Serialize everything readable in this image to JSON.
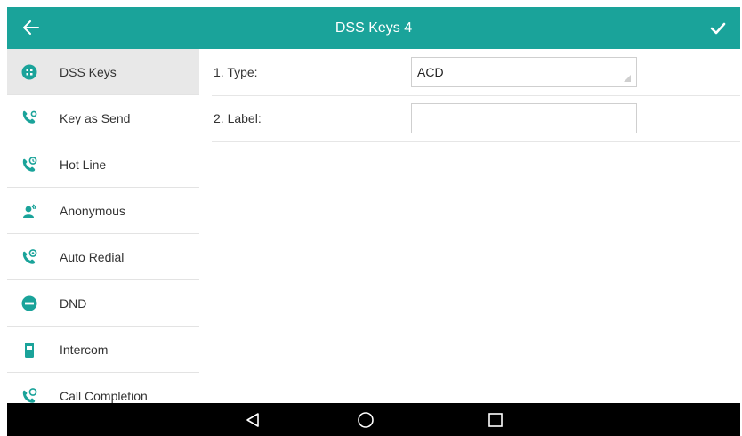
{
  "header": {
    "title": "DSS Keys 4",
    "back_icon": "back-arrow-icon",
    "confirm_icon": "checkmark-icon"
  },
  "sidebar": {
    "items": [
      {
        "label": "DSS Keys",
        "icon": "dss-keys-icon",
        "active": true
      },
      {
        "label": "Key as Send",
        "icon": "key-as-send-icon",
        "active": false
      },
      {
        "label": "Hot Line",
        "icon": "hot-line-icon",
        "active": false
      },
      {
        "label": "Anonymous",
        "icon": "anonymous-icon",
        "active": false
      },
      {
        "label": "Auto Redial",
        "icon": "auto-redial-icon",
        "active": false
      },
      {
        "label": "DND",
        "icon": "dnd-icon",
        "active": false
      },
      {
        "label": "Intercom",
        "icon": "intercom-icon",
        "active": false
      },
      {
        "label": "Call Completion",
        "icon": "call-completion-icon",
        "active": false
      }
    ]
  },
  "form": {
    "type_label": "1. Type:",
    "type_value": "ACD",
    "label_label": "2. Label:",
    "label_value": ""
  },
  "navbar": {
    "back_icon": "nav-back-icon",
    "home_icon": "nav-home-icon",
    "recents_icon": "nav-recents-icon"
  },
  "colors": {
    "accent": "#1aa39a",
    "navbar": "#000000"
  }
}
